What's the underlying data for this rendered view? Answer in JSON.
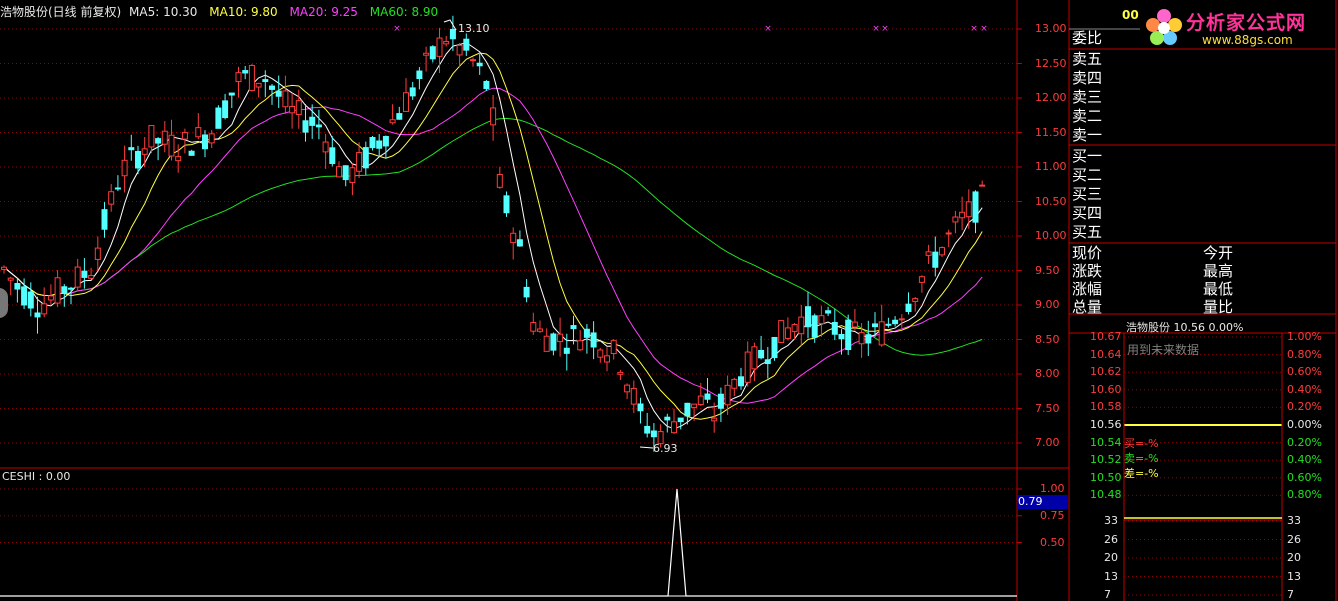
{
  "header": {
    "stock_title": "浩物股份(日线 前复权)",
    "ma5": "MA5: 10.30",
    "ma10": "MA10: 9.80",
    "ma20": "MA20: 9.25",
    "ma60": "MA60: 8.90"
  },
  "main_chart": {
    "y_axis": [
      "13.00",
      "12.50",
      "12.00",
      "11.50",
      "11.00",
      "10.50",
      "10.00",
      "9.50",
      "9.00",
      "8.50",
      "8.00",
      "7.50",
      "7.00"
    ],
    "high_marker": "13.10",
    "low_marker": "6.93",
    "ylim": [
      6.7,
      13.3
    ]
  },
  "sub_chart": {
    "title": "CESHI : 0.00",
    "y_axis": [
      "1.00",
      "0.75",
      "0.50"
    ],
    "cursor_value": "0.79"
  },
  "order_book": {
    "ratio_label": "委比",
    "sell": [
      "卖五",
      "卖四",
      "卖三",
      "卖二",
      "卖一"
    ],
    "buy": [
      "买一",
      "买二",
      "买三",
      "买四",
      "买五"
    ],
    "stats_left": [
      "现价",
      "涨跌",
      "涨幅",
      "总量"
    ],
    "stats_right": [
      "今开",
      "最高",
      "最低",
      "量比"
    ],
    "code_partial": "00"
  },
  "intraday": {
    "title": "浩物股份  10.56  0.00%",
    "future_data": "用到未来数据",
    "prices": [
      "10.67",
      "10.64",
      "10.62",
      "10.60",
      "10.58",
      "10.56",
      "10.54",
      "10.52",
      "10.50",
      "10.48"
    ],
    "percents": [
      "1.00%",
      "0.80%",
      "0.60%",
      "0.40%",
      "0.20%",
      "0.00%",
      "0.20%",
      "0.40%",
      "0.60%",
      "0.80%"
    ],
    "buy_line": "买=-%",
    "sell_line": "卖=-%",
    "diff_line": "差=-%",
    "volume_axis": [
      "33",
      "26",
      "20",
      "13",
      "7"
    ]
  },
  "logo": {
    "text": "分析家公式网",
    "url": "www.88gs.com"
  },
  "colors": {
    "up": "#ff3c3c",
    "down": "#54ffff",
    "ma5": "#ffffff",
    "ma10": "#ffff40",
    "ma20": "#ff40ff",
    "ma60": "#22e022",
    "grid": "#8b0000",
    "frame": "#c00000"
  }
}
